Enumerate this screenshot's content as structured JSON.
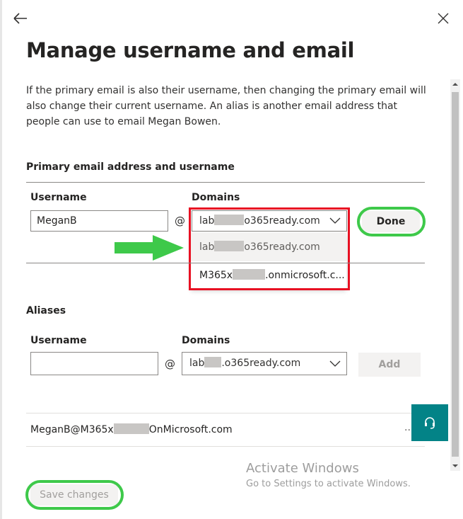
{
  "panel": {
    "title": "Manage username and email",
    "description": "If the primary email is also their username, then changing the primary email will also change their current username. An alias is another email address that people can use to email Megan Bowen."
  },
  "icons": {
    "back": "back-arrow-icon",
    "close": "close-icon",
    "chevron": "chevron-down-icon",
    "help": "headset-icon",
    "annotation_arrow": "green-arrow-icon"
  },
  "primary": {
    "section_title": "Primary email address and username",
    "username_label": "Username",
    "username_value": "MeganB",
    "at": "@",
    "domains_label": "Domains",
    "domain_selected_prefix": "lab",
    "domain_selected_suffix": "o365ready.com",
    "done_label": "Done"
  },
  "dropdown": {
    "options": [
      {
        "prefix": "lab",
        "suffix": "o365ready.com",
        "highlighted": true
      },
      {
        "prefix": "M365x",
        "suffix": ".onmicrosoft.c..."
      }
    ]
  },
  "aliases": {
    "section_title": "Aliases",
    "username_label": "Username",
    "username_value": "",
    "at": "@",
    "domains_label": "Domains",
    "domain_selected_prefix": "lab",
    "domain_selected_suffix": ".o365ready.com",
    "add_label": "Add",
    "list": [
      {
        "prefix": "MeganB@M365x",
        "suffix": "OnMicrosoft.com",
        "more": "..."
      }
    ]
  },
  "footer": {
    "save_label": "Save changes"
  },
  "watermark": {
    "title": "Activate Windows",
    "subtitle": "Go to Settings to activate Windows."
  },
  "colors": {
    "annotation_red": "#e81123",
    "annotation_green": "#3ec94a",
    "help_teal": "#038387"
  }
}
